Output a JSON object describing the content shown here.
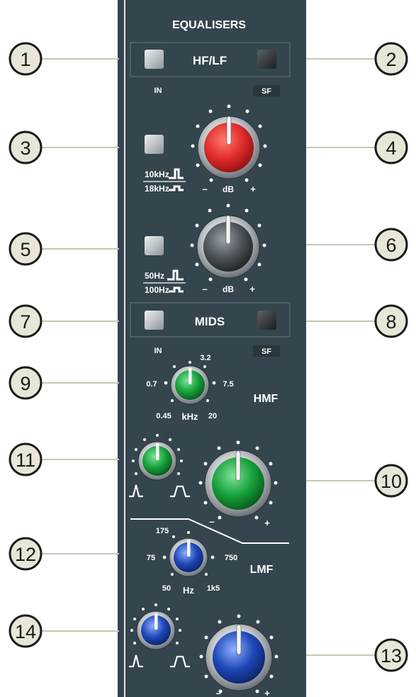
{
  "colors": {
    "panel": "#34454d",
    "panel_dark": "#2b3a41",
    "label": "#ffffff",
    "red_knob": "#e02c2c",
    "grey_knob": "#3f4448",
    "green_knob": "#16a13a",
    "blue_knob": "#1e47b8",
    "callout_fill": "#e8e6d6",
    "callout_line": "#c8c6b4"
  },
  "strip": {
    "title": "EQUALISERS",
    "hf_lf": {
      "label": "HF/LF",
      "in_label": "IN",
      "sf_label": "SF"
    },
    "hf": {
      "label_a": "10kHz",
      "label_b": "18kHz",
      "minus": "–",
      "plus": "+",
      "unit": "dB",
      "knob_icon": "red-knob-icon"
    },
    "lf": {
      "label_a": "50Hz",
      "label_b": "100Hz",
      "minus": "–",
      "plus": "+",
      "unit": "dB",
      "knob_icon": "grey-knob-icon"
    },
    "mids": {
      "label": "MIDS",
      "in_label": "IN",
      "sf_label": "SF"
    },
    "hmf": {
      "label": "HMF",
      "unit": "kHz",
      "scale": [
        "0.45",
        "0.7",
        "3.2",
        "7.5",
        "20"
      ],
      "knob_icon": "green-knob-icon"
    },
    "hmf_gain": {
      "minus": "–",
      "plus": "+"
    },
    "lmf": {
      "label": "LMF",
      "unit": "Hz",
      "scale": [
        "50",
        "75",
        "175",
        "750",
        "1k5"
      ],
      "knob_icon": "blue-knob-icon"
    },
    "lmf_gain": {
      "minus": "–",
      "plus": "+"
    }
  },
  "callouts": [
    "1",
    "2",
    "3",
    "4",
    "5",
    "6",
    "7",
    "8",
    "9",
    "10",
    "11",
    "12",
    "13",
    "14"
  ]
}
